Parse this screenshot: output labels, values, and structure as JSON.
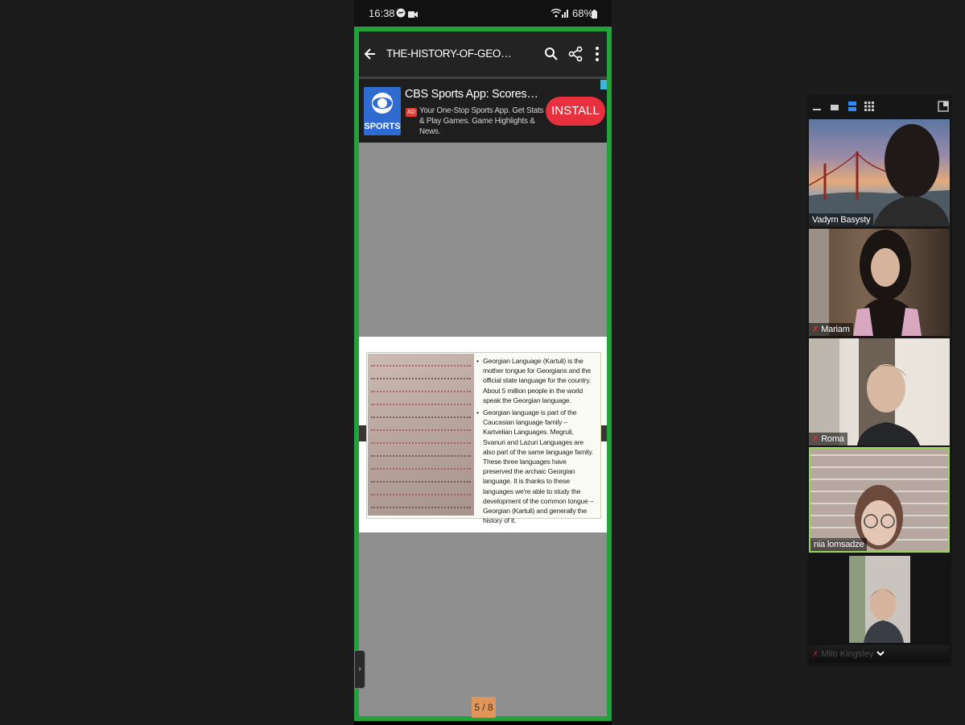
{
  "status_bar": {
    "time": "16:38",
    "battery": "68%"
  },
  "app_bar": {
    "title": "THE-HISTORY-OF-GEORGIA-LANG..."
  },
  "ad": {
    "title": "CBS Sports App: Scores & N...",
    "badge": "AD",
    "description": "Your One-Stop Sports App. Get Stats & Play Games. Game Highlights & News.",
    "logo_text": "SPORTS",
    "cta": "INSTALL"
  },
  "slide": {
    "bullets": [
      "Georgian Language (Kartuli) is the mother tongue for Georgians and the official state language for the country. About 5 million people in the world speak the Georgian language.",
      "Georgian  language is part of the Caucasian language family – Kartvelian Languages. Megruli, Svanuri  and Lazuri Languages are also part of the same language family. These three languages have preserved the archaic Georgian language. It is thanks to these languages we're able to study the development of the common tongue – Georgian (Kartuli) and generally the history of it."
    ]
  },
  "page_indicator": "5 / 8",
  "participants": [
    {
      "name": "Vadym Basysty",
      "muted": false
    },
    {
      "name": "Mariam",
      "muted": true
    },
    {
      "name": "Roma",
      "muted": true
    },
    {
      "name": "nia lomsadze",
      "muted": false,
      "active_speaker": true
    },
    {
      "name": "Milo Kingsley",
      "muted": true
    }
  ],
  "colors": {
    "share_border": "#1fa33a",
    "install": "#e8303f",
    "active_speaker": "#9bd45a"
  }
}
